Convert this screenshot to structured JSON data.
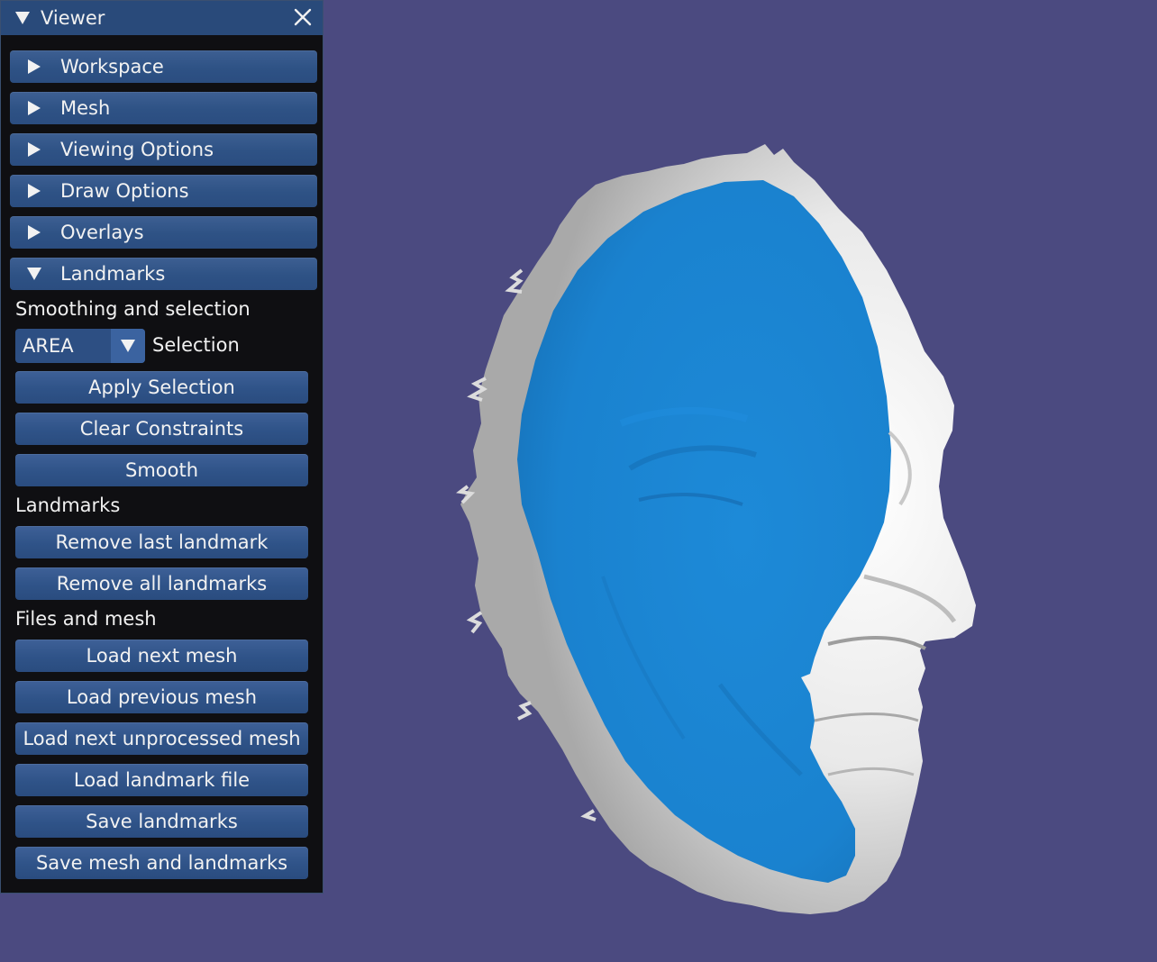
{
  "window": {
    "title": "Viewer"
  },
  "menu": [
    {
      "label": "Workspace",
      "expanded": false
    },
    {
      "label": "Mesh",
      "expanded": false
    },
    {
      "label": "Viewing Options",
      "expanded": false
    },
    {
      "label": "Draw Options",
      "expanded": false
    },
    {
      "label": "Overlays",
      "expanded": false
    },
    {
      "label": "Landmarks",
      "expanded": true
    }
  ],
  "landmarks": {
    "smoothing_section": "Smoothing and selection",
    "selection_mode": {
      "value": "AREA",
      "label": "Selection"
    },
    "apply_selection": "Apply Selection",
    "clear_constraints": "Clear Constraints",
    "smooth": "Smooth",
    "landmarks_section": "Landmarks",
    "remove_last": "Remove last landmark",
    "remove_all": "Remove all landmarks",
    "files_section": "Files and mesh",
    "load_next_mesh": "Load next mesh",
    "load_previous_mesh": "Load previous mesh",
    "load_next_unprocessed": "Load next unprocessed mesh",
    "load_landmark_file": "Load landmark file",
    "save_landmarks": "Save landmarks",
    "save_mesh_and_landmarks": "Save mesh and landmarks"
  },
  "colors": {
    "background": "#4b4a80",
    "panel": "#0f0f12",
    "header": "#2e5285",
    "selection": "#1a85d2",
    "mesh": "#e6e6e6"
  }
}
